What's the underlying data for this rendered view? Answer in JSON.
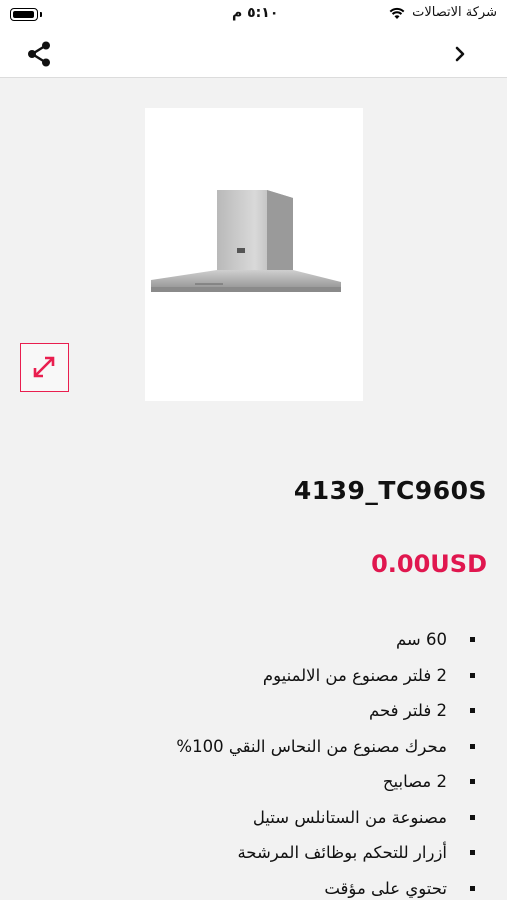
{
  "status_bar": {
    "carrier": "شركة الاتصالات",
    "time": "٥:١٠ م"
  },
  "product": {
    "title": "4139_TC960S",
    "price": "0.00USD",
    "features": [
      "60 سم",
      "2 فلتر مصنوع من الالمنيوم",
      "2 فلتر فحم",
      "محرك مصنوع من النحاس النقي 100%",
      "2 مصابيح",
      "مصنوعة من الستانلس ستيل",
      "أزرار للتحكم بوظائف المرشحة",
      "تحتوي على مؤقت"
    ]
  },
  "colors": {
    "accent": "#e0174f",
    "background": "#f2f2f2"
  },
  "icons": {
    "share": "share-icon",
    "back": "chevron-right-icon",
    "expand": "expand-icon"
  }
}
